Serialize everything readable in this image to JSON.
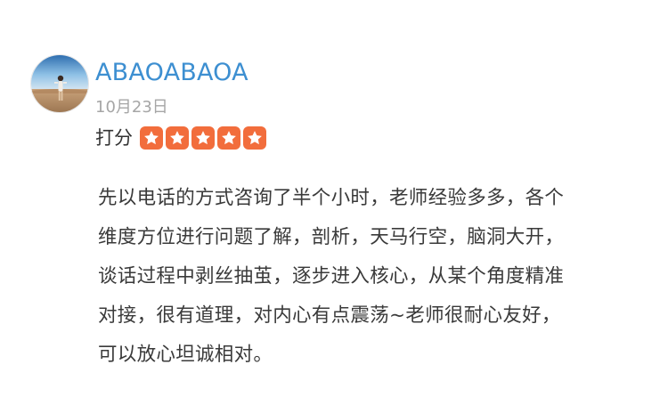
{
  "review": {
    "username": "ABAOABAOA",
    "date": "10月23日",
    "rating_label": "打分",
    "rating": 5,
    "rating_max": 5,
    "star_color": "#f26d3c",
    "username_color": "#3d8fd1",
    "content_lines": [
      "先以电话的方式咨询了半个小时，老师经验多多，各个",
      "维度方位进行问题了解，剖析，天马行空，脑洞大开，",
      "谈话过程中剥丝抽茧，逐步进入核心，从某个角度精准",
      "对接，很有道理，对内心有点震荡~老师很耐心友好，",
      "可以放心坦诚相对。"
    ]
  }
}
